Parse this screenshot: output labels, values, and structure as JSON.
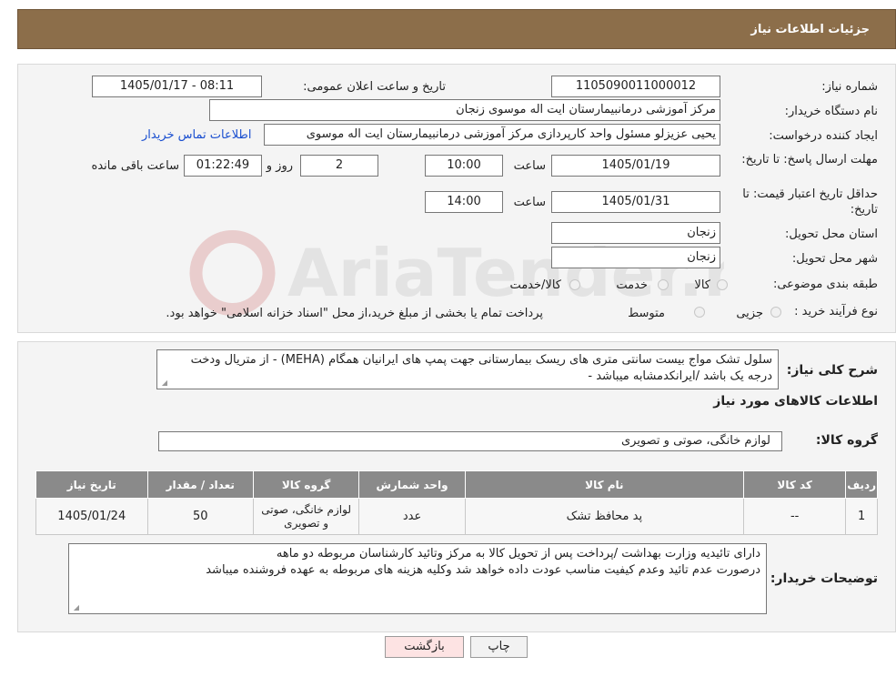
{
  "header": {
    "title": "جزئیات اطلاعات نیاز"
  },
  "form": {
    "need_number_label": "شماره نیاز:",
    "need_number": "1105090011000012",
    "announce_label": "تاریخ و ساعت اعلان عمومی:",
    "announce_value": "1405/01/17 - 08:11",
    "buyer_org_label": "نام دستگاه خریدار:",
    "buyer_org": "مرکز آموزشی درمانبیمارستان ایت اله موسوی زنجان",
    "requester_label": "ایجاد کننده درخواست:",
    "requester": "یحیی عزیزلو مسئول واحد کارپردازی مرکز آموزشی درمانبیمارستان ایت اله موسوی",
    "contact_link": "اطلاعات تماس خریدار",
    "deadline_label": "مهلت ارسال پاسخ: تا تاریخ:",
    "deadline_date": "1405/01/19",
    "time_label": "ساعت",
    "deadline_time": "10:00",
    "days_value": "2",
    "days_label": "روز و",
    "remaining_value": "01:22:49",
    "remaining_label": "ساعت باقی مانده",
    "validity_label": "حداقل تاریخ اعتبار قیمت: تا تاریخ:",
    "validity_date": "1405/01/31",
    "validity_time": "14:00",
    "province_label": "استان محل تحویل:",
    "province": "زنجان",
    "city_label": "شهر محل تحویل:",
    "city": "زنجان",
    "category_label": "طبقه بندی موضوعی:",
    "category_options": [
      "کالا",
      "خدمت",
      "کالا/خدمت"
    ],
    "process_label": "نوع فرآیند خرید :",
    "process_options": [
      "جزیی",
      "متوسط"
    ],
    "process_note": "پرداخت تمام یا بخشی از مبلغ خرید،از محل \"اسناد خزانه اسلامی\" خواهد بود."
  },
  "summary": {
    "description_label": "شرح کلی نیاز:",
    "description": "سلول تشک مواج بیست سانتی متری های ریسک بیمارستانی جهت پمپ های ایرانیان همگام (MEHA) - از متریال  ودخت درجه یک باشد /ایرانکدمشابه میباشد -",
    "goods_info_title": "اطلاعات کالاهای مورد نیاز",
    "group_label": "گروه کالا:",
    "group_value": "لوازم خانگی، صوتی و تصویری"
  },
  "table": {
    "headers": [
      "ردیف",
      "کد کالا",
      "نام کالا",
      "واحد شمارش",
      "گروه کالا",
      "تعداد / مقدار",
      "تاریخ نیاز"
    ],
    "rows": [
      [
        "1",
        "--",
        "پد محافظ تشک",
        "عدد",
        "لوازم خانگی، صوتی و تصویری",
        "50",
        "1405/01/24"
      ]
    ]
  },
  "buyer_notes": {
    "label": "توضیحات خریدار:",
    "line1": "دارای تائیدیه وزارت بهداشت /پرداخت پس از تحویل کالا به مرکز وتائید کارشناسان مربوطه دو ماهه",
    "line2": "درصورت عدم تائید وعدم کیفیت مناسب عودت داده خواهد شد وکلیه هزینه های مربوطه به عهده فروشنده میباشد"
  },
  "buttons": {
    "print": "چاپ",
    "back": "بازگشت"
  },
  "watermark": {
    "text": "AriaTender.neT"
  },
  "colors": {
    "header": "#8c6e4a",
    "table_header": "#8a8a8a",
    "link": "#1a4fd0",
    "back_button": "#fde3e3"
  }
}
